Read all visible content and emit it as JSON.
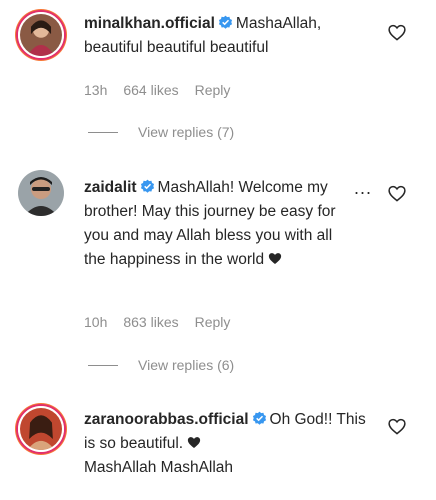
{
  "comments": [
    {
      "username": "minalkhan.official",
      "text": "MashaAllah, beautiful beautiful beautiful",
      "time": "13h",
      "likes": "664 likes",
      "reply": "Reply",
      "view_replies": "View replies (7)"
    },
    {
      "username": "zaidalit",
      "text": "MashAllah! Welcome my brother! May this journey be easy for you and may Allah bless you with all the happiness in the world",
      "time": "10h",
      "likes": "863 likes",
      "reply": "Reply",
      "view_replies": "View replies (6)",
      "more": "..."
    },
    {
      "username": "zaranoorabbas.official",
      "text": "Oh God!! This is so beautiful.",
      "text2": "MashAllah MashAllah"
    }
  ],
  "icons": {
    "verified": "verified-badge-icon",
    "like": "heart-outline-icon",
    "inline_heart": "black-heart-emoji"
  },
  "colors": {
    "verified_blue": "#3897f0",
    "meta_gray": "#8e8e8e",
    "text": "#262626"
  }
}
